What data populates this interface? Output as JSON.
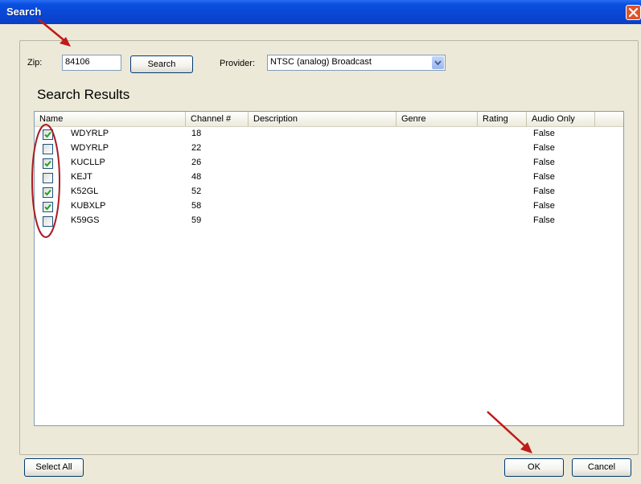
{
  "window": {
    "title": "Search"
  },
  "search": {
    "zip_label": "Zip:",
    "zip_value": "84106",
    "search_button": "Search",
    "provider_label": "Provider:",
    "provider_value": "NTSC (analog) Broadcast"
  },
  "results": {
    "title": "Search Results",
    "columns": [
      "Name",
      "Channel #",
      "Description",
      "Genre",
      "Rating",
      "Audio Only"
    ],
    "rows": [
      {
        "checked": true,
        "name": "WDYRLP",
        "channel": "18",
        "description": "",
        "genre": "",
        "rating": "",
        "audio_only": "False"
      },
      {
        "checked": false,
        "name": "WDYRLP",
        "channel": "22",
        "description": "",
        "genre": "",
        "rating": "",
        "audio_only": "False"
      },
      {
        "checked": true,
        "name": "KUCLLP",
        "channel": "26",
        "description": "",
        "genre": "",
        "rating": "",
        "audio_only": "False"
      },
      {
        "checked": false,
        "name": "KEJT",
        "channel": "48",
        "description": "",
        "genre": "",
        "rating": "",
        "audio_only": "False"
      },
      {
        "checked": true,
        "name": "K52GL",
        "channel": "52",
        "description": "",
        "genre": "",
        "rating": "",
        "audio_only": "False"
      },
      {
        "checked": true,
        "name": "KUBXLP",
        "channel": "58",
        "description": "",
        "genre": "",
        "rating": "",
        "audio_only": "False"
      },
      {
        "checked": false,
        "name": "K59GS",
        "channel": "59",
        "description": "",
        "genre": "",
        "rating": "",
        "audio_only": "False"
      }
    ]
  },
  "footer": {
    "select_all": "Select All",
    "ok": "OK",
    "cancel": "Cancel"
  },
  "colors": {
    "titlebar": "#0a46d4",
    "dialog_bg": "#ece9d8",
    "annotation_red": "#c01a1a",
    "check_green": "#21a121"
  },
  "icons": {
    "close": "close-icon",
    "dropdown": "chevron-down-icon",
    "check": "checkmark-icon"
  }
}
